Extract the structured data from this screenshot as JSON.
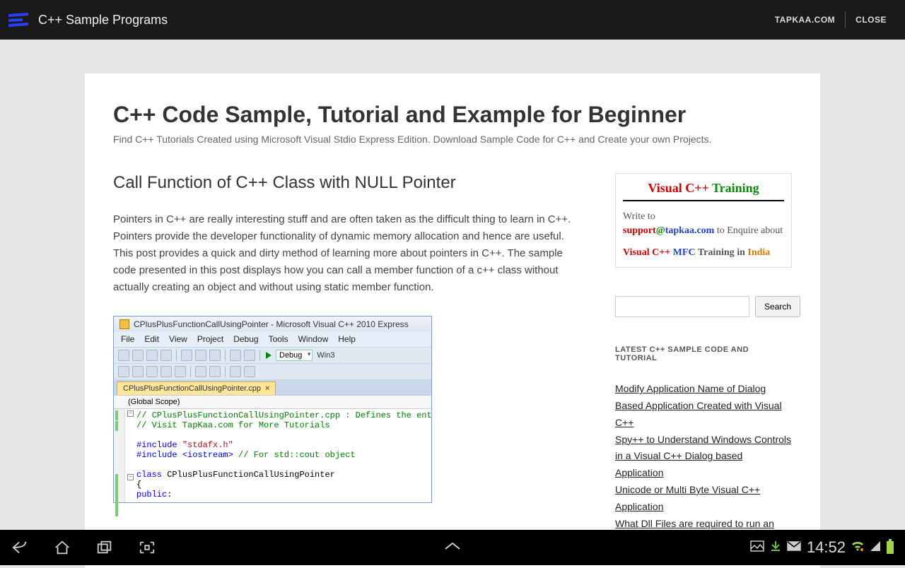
{
  "top": {
    "app_title": "C++ Sample Programs",
    "link1": "TAPKAA.COM",
    "link2": "CLOSE"
  },
  "page": {
    "title": "C++ Code Sample, Tutorial and Example for Beginner",
    "subtitle": "Find C++ Tutorials Created using Microsoft Visual Stdio Express Edition. Download Sample Code for C++ and Create your own Projects."
  },
  "article": {
    "title": "Call Function of C++ Class with NULL Pointer",
    "body": "Pointers in C++ are really interesting stuff and are often taken as the difficult thing to learn in C++. Pointers provide the developer functionality of dynamic memory allocation and hence are useful. This post provides a quick and dirty method of learning more about pointers in C++. The sample code presented in this post displays how you can call a member function of a c++ class without actually creating an object and without using static member function."
  },
  "vs": {
    "title": "CPlusPlusFunctionCallUsingPointer - Microsoft Visual C++ 2010 Express",
    "menu": [
      "File",
      "Edit",
      "View",
      "Project",
      "Debug",
      "Tools",
      "Window",
      "Help"
    ],
    "combo": "Debug",
    "combo2": "Win3",
    "tab": "CPlusPlusFunctionCallUsingPointer.cpp",
    "scope": "(Global Scope)",
    "code": {
      "l1a": "// CPlusPlusFunctionCallUsingPointer.cpp : Defines the ent",
      "l2": "// Visit TapKaa.com for More Tutorials",
      "l3a": "#include ",
      "l3b": "\"stdafx.h\"",
      "l4a": "#include ",
      "l4b": "<iostream>",
      "l4c": " // For std::cout object",
      "l5a": "class",
      "l5b": " CPlusPlusFunctionCallUsingPointer",
      "l6": "{",
      "l7a": "public",
      "l7b": ":"
    }
  },
  "promo": {
    "vcpp": "Visual C++",
    "train": "Training",
    "write": "Write to",
    "email": "support",
    "at": "@",
    "domain": "tapkaa.com",
    "to": " to Enquire about",
    "vcpp2": "Visual C++",
    "mfc": "MFC",
    "training2": "Training",
    "in": "in",
    "india": "India"
  },
  "search": {
    "btn": "Search"
  },
  "latest": {
    "title": "LATEST C++ SAMPLE CODE AND TUTORIAL",
    "items": [
      "Modify Application Name of Dialog Based Application Created with Visual C++",
      "Spy++ to Understand Windows Controls in a Visual C++ Dialog based Application",
      "Unicode or Multi Byte Visual C++ Application",
      "What Dll Files are required to run an"
    ]
  },
  "status": {
    "time": "14:52"
  }
}
